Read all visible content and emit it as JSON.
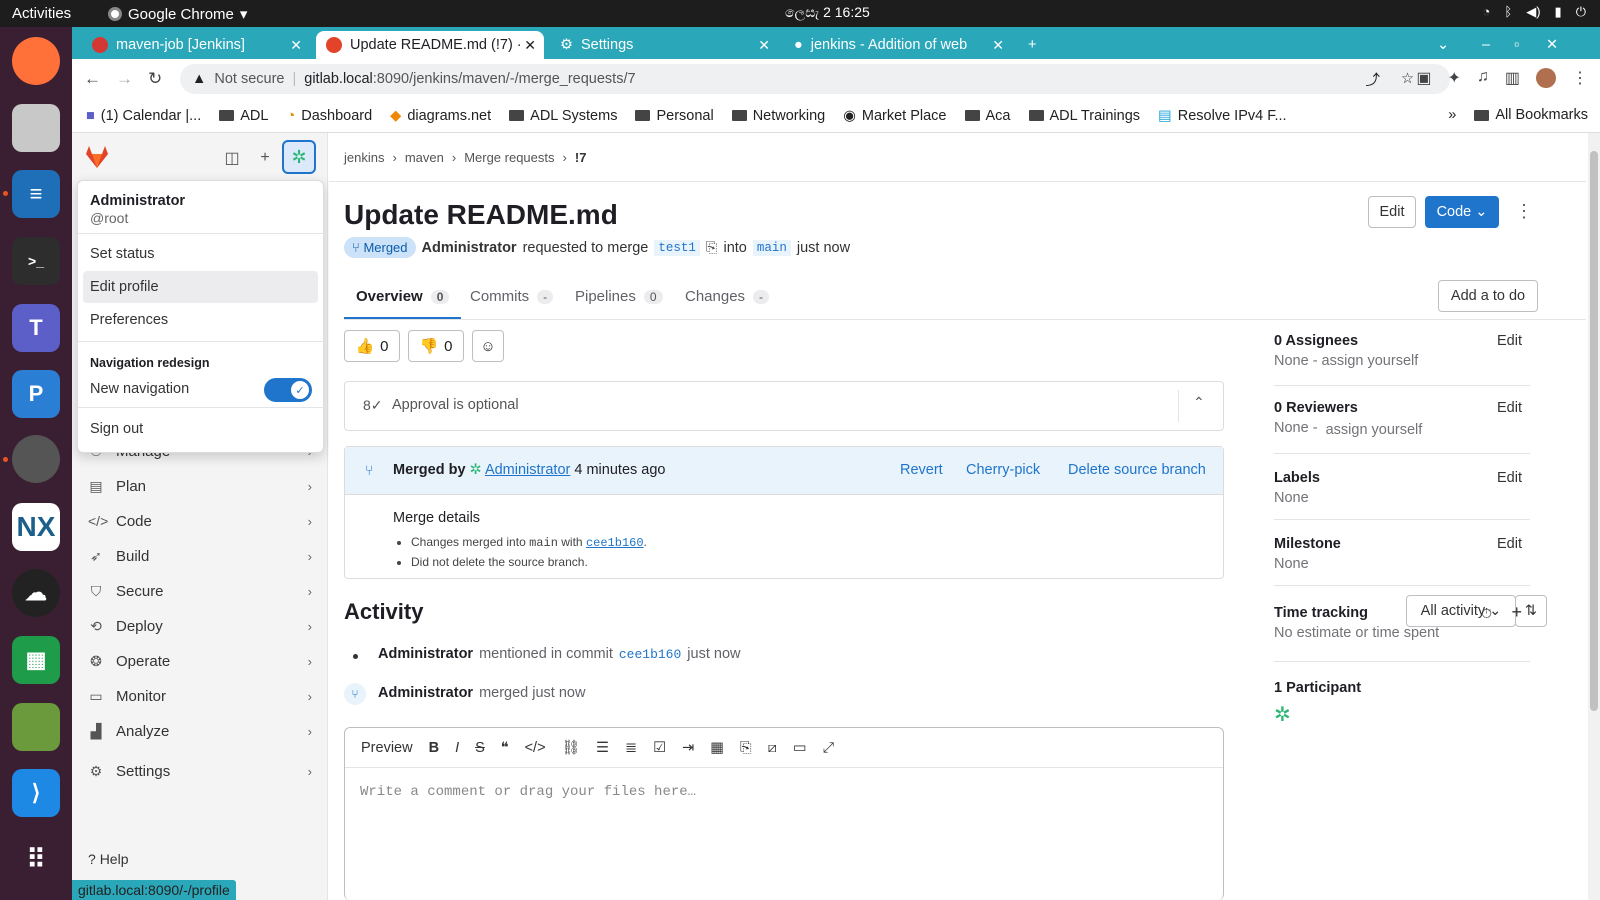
{
  "os": {
    "activities": "Activities",
    "app": "Google Chrome",
    "clock": "ලෙසැ  2  16:25"
  },
  "tabs": [
    {
      "label": "maven-job [Jenkins]",
      "color": "#d33833"
    },
    {
      "label": "Update README.md (!7) ·",
      "color": "#e24329"
    },
    {
      "label": "Settings",
      "color": "#444"
    },
    {
      "label": "jenkins - Addition of web",
      "color": "#333"
    }
  ],
  "omnibox": {
    "security": "Not secure",
    "host": "gitlab.local",
    "path": ":8090/jenkins/maven/-/merge_requests/7"
  },
  "bookmarks": [
    "(1) Calendar |...",
    "ADL",
    "Dashboard",
    "diagrams.net",
    "ADL Systems",
    "Personal",
    "Networking",
    "Market Place",
    "Aca",
    "ADL Trainings",
    "Resolve IPv4 F...",
    "All Bookmarks"
  ],
  "sidebar": {
    "items": [
      "Manage",
      "Plan",
      "Code",
      "Build",
      "Secure",
      "Deploy",
      "Operate",
      "Monitor",
      "Analyze",
      "Settings"
    ],
    "help": "Help"
  },
  "dropdown": {
    "name": "Administrator",
    "username": "@root",
    "set_status": "Set status",
    "edit_profile": "Edit profile",
    "preferences": "Preferences",
    "nav_header": "Navigation redesign",
    "new_nav": "New navigation",
    "sign_out": "Sign out"
  },
  "statusbar": "gitlab.local:8090/-/profile",
  "breadcrumb": [
    "jenkins",
    "maven",
    "Merge requests",
    "!7"
  ],
  "mr": {
    "title": "Update README.md",
    "status": "Merged",
    "author": "Administrator",
    "requested": "requested to merge",
    "source": "test1",
    "into": "into",
    "target": "main",
    "when": "just now",
    "edit": "Edit",
    "code": "Code"
  },
  "mr_tabs": [
    {
      "label": "Overview",
      "count": "0"
    },
    {
      "label": "Commits",
      "count": "-"
    },
    {
      "label": "Pipelines",
      "count": "0"
    },
    {
      "label": "Changes",
      "count": "-"
    }
  ],
  "todo": "Add a to do",
  "reactions": {
    "up": "0",
    "down": "0"
  },
  "approval": "Approval is optional",
  "merged": {
    "by": "Merged by",
    "user": "Administrator",
    "ago": "4 minutes ago",
    "revert": "Revert",
    "cherry": "Cherry-pick",
    "delete": "Delete source branch",
    "details_title": "Merge details",
    "line1_a": "Changes merged into",
    "line1_branch": "main",
    "line1_b": "with",
    "commit": "cee1b160",
    "line2": "Did not delete the source branch."
  },
  "activity": {
    "title": "Activity",
    "filter": "All activity",
    "n1_user": "Administrator",
    "n1_text": "mentioned in commit",
    "n1_commit": "cee1b160",
    "n1_when": "just now",
    "n2_user": "Administrator",
    "n2_text": "merged just now"
  },
  "editor": {
    "preview": "Preview",
    "placeholder": "Write a comment or drag your files here…"
  },
  "right": {
    "assignees": "0 Assignees",
    "assignees_v": "None - assign yourself",
    "reviewers": "0 Reviewers",
    "reviewers_none": "None -",
    "reviewers_v": "assign yourself",
    "labels": "Labels",
    "labels_v": "None",
    "milestone": "Milestone",
    "milestone_v": "None",
    "time": "Time tracking",
    "time_v": "No estimate or time spent",
    "participants": "1 Participant",
    "edit": "Edit"
  }
}
